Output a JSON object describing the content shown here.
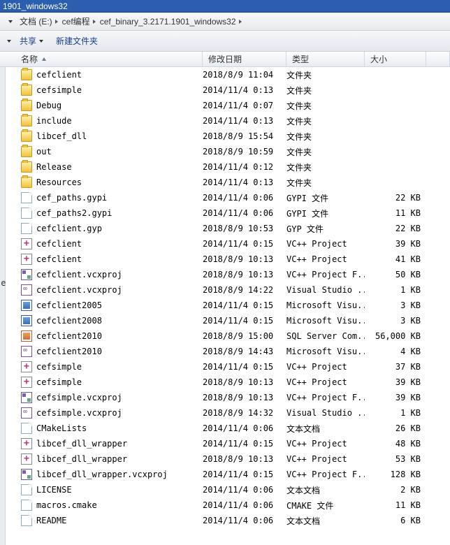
{
  "window_title": "1901_windows32",
  "breadcrumb": {
    "items": [
      "文档 (E:)",
      "cef编程",
      "cef_binary_3.2171.1901_windows32"
    ]
  },
  "toolbar": {
    "share": "共享",
    "new_folder": "新建文件夹"
  },
  "columns": {
    "name": "名称",
    "date": "修改日期",
    "type": "类型",
    "size": "大小"
  },
  "left_fragment": "le",
  "files": [
    {
      "icon": "folder",
      "name": "cefclient",
      "date": "2018/8/9 11:04",
      "type": "文件夹",
      "size": ""
    },
    {
      "icon": "folder",
      "name": "cefsimple",
      "date": "2014/11/4 0:13",
      "type": "文件夹",
      "size": ""
    },
    {
      "icon": "folder",
      "name": "Debug",
      "date": "2014/11/4 0:07",
      "type": "文件夹",
      "size": ""
    },
    {
      "icon": "folder",
      "name": "include",
      "date": "2014/11/4 0:13",
      "type": "文件夹",
      "size": ""
    },
    {
      "icon": "folder",
      "name": "libcef_dll",
      "date": "2018/8/9 15:54",
      "type": "文件夹",
      "size": ""
    },
    {
      "icon": "folder",
      "name": "out",
      "date": "2018/8/9 10:59",
      "type": "文件夹",
      "size": ""
    },
    {
      "icon": "folder",
      "name": "Release",
      "date": "2014/11/4 0:12",
      "type": "文件夹",
      "size": ""
    },
    {
      "icon": "folder",
      "name": "Resources",
      "date": "2014/11/4 0:13",
      "type": "文件夹",
      "size": ""
    },
    {
      "icon": "file",
      "name": "cef_paths.gypi",
      "date": "2014/11/4 0:06",
      "type": "GYPI 文件",
      "size": "22 KB"
    },
    {
      "icon": "file",
      "name": "cef_paths2.gypi",
      "date": "2014/11/4 0:06",
      "type": "GYPI 文件",
      "size": "11 KB"
    },
    {
      "icon": "file",
      "name": "cefclient.gyp",
      "date": "2018/8/9 10:53",
      "type": "GYP 文件",
      "size": "22 KB"
    },
    {
      "icon": "vcproj-plus",
      "name": "cefclient",
      "date": "2014/11/4 0:15",
      "type": "VC++ Project",
      "size": "39 KB"
    },
    {
      "icon": "vcproj-plus",
      "name": "cefclient",
      "date": "2018/8/9 10:13",
      "type": "VC++ Project",
      "size": "41 KB"
    },
    {
      "icon": "vcxproj",
      "name": "cefclient.vcxproj",
      "date": "2018/8/9 10:13",
      "type": "VC++ Project F...",
      "size": "50 KB"
    },
    {
      "icon": "studio",
      "name": "cefclient.vcxproj",
      "date": "2018/8/9 14:22",
      "type": "Visual Studio ...",
      "size": "1 KB"
    },
    {
      "icon": "msvisu",
      "name": "cefclient2005",
      "date": "2014/11/4 0:15",
      "type": "Microsoft Visu...",
      "size": "3 KB"
    },
    {
      "icon": "msvisu",
      "name": "cefclient2008",
      "date": "2014/11/4 0:15",
      "type": "Microsoft Visu...",
      "size": "3 KB"
    },
    {
      "icon": "sql",
      "name": "cefclient2010",
      "date": "2018/8/9 15:00",
      "type": "SQL Server Com...",
      "size": "56,000 KB"
    },
    {
      "icon": "studio",
      "name": "cefclient2010",
      "date": "2018/8/9 14:43",
      "type": "Microsoft Visu...",
      "size": "4 KB"
    },
    {
      "icon": "vcproj-plus",
      "name": "cefsimple",
      "date": "2014/11/4 0:15",
      "type": "VC++ Project",
      "size": "37 KB"
    },
    {
      "icon": "vcproj-plus",
      "name": "cefsimple",
      "date": "2018/8/9 10:13",
      "type": "VC++ Project",
      "size": "39 KB"
    },
    {
      "icon": "vcxproj",
      "name": "cefsimple.vcxproj",
      "date": "2018/8/9 10:13",
      "type": "VC++ Project F...",
      "size": "39 KB"
    },
    {
      "icon": "studio",
      "name": "cefsimple.vcxproj",
      "date": "2018/8/9 14:32",
      "type": "Visual Studio ...",
      "size": "1 KB"
    },
    {
      "icon": "file",
      "name": "CMakeLists",
      "date": "2014/11/4 0:06",
      "type": "文本文档",
      "size": "26 KB"
    },
    {
      "icon": "vcproj-plus",
      "name": "libcef_dll_wrapper",
      "date": "2014/11/4 0:15",
      "type": "VC++ Project",
      "size": "48 KB"
    },
    {
      "icon": "vcproj-plus",
      "name": "libcef_dll_wrapper",
      "date": "2018/8/9 10:13",
      "type": "VC++ Project",
      "size": "53 KB"
    },
    {
      "icon": "vcxproj",
      "name": "libcef_dll_wrapper.vcxproj",
      "date": "2014/11/4 0:15",
      "type": "VC++ Project F...",
      "size": "128 KB"
    },
    {
      "icon": "file",
      "name": "LICENSE",
      "date": "2014/11/4 0:06",
      "type": "文本文档",
      "size": "2 KB"
    },
    {
      "icon": "file",
      "name": "macros.cmake",
      "date": "2014/11/4 0:06",
      "type": "CMAKE 文件",
      "size": "11 KB"
    },
    {
      "icon": "file",
      "name": "README",
      "date": "2014/11/4 0:06",
      "type": "文本文档",
      "size": "6 KB"
    }
  ]
}
